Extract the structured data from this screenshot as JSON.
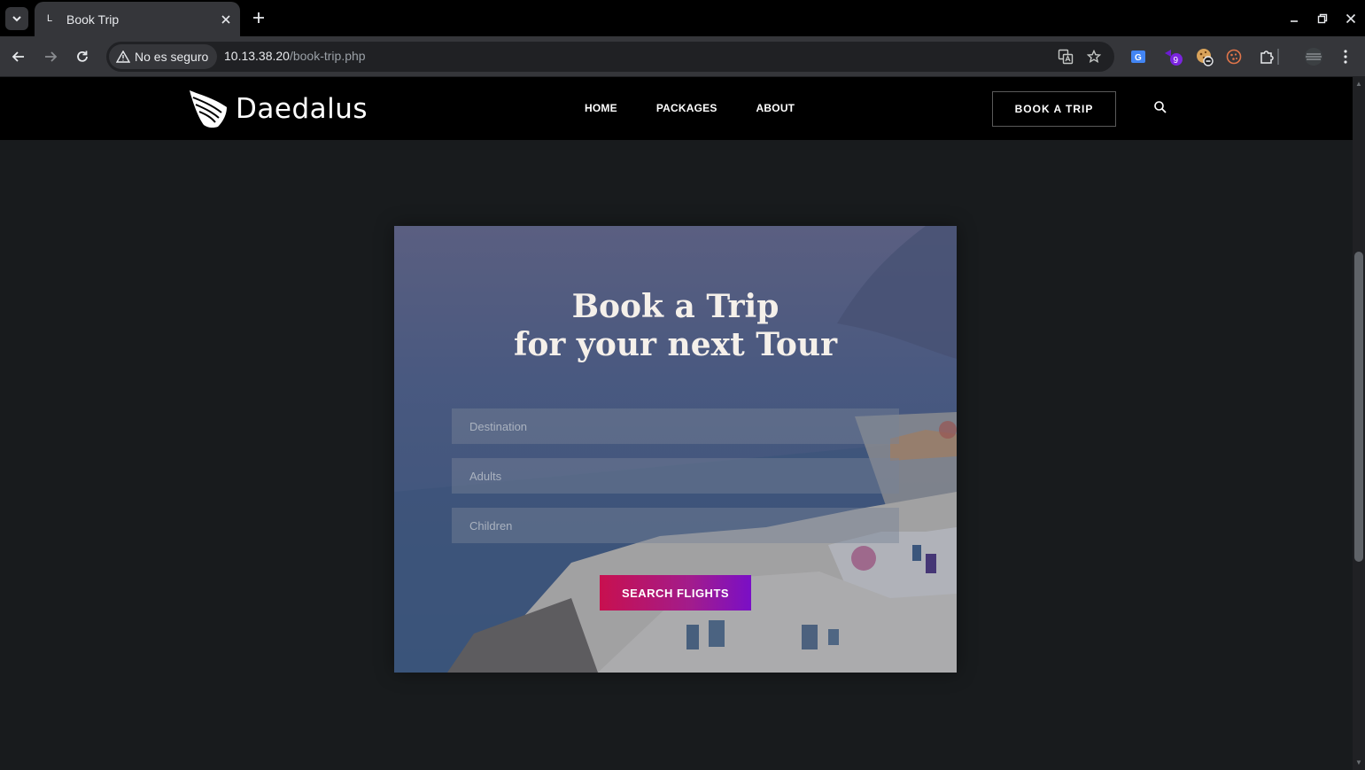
{
  "browser": {
    "tab_title": "Book Trip",
    "tab_favicon": "L",
    "security_label": "No es seguro",
    "url_host": "10.13.38.20",
    "url_path": "/book-trip.php",
    "extension_badge": "9"
  },
  "site": {
    "logo_text": "Daedalus",
    "nav": [
      "HOME",
      "PACKAGES",
      "ABOUT"
    ],
    "cta_label": "BOOK A TRIP"
  },
  "booking": {
    "title_line1": "Book a Trip",
    "title_line2": "for your next Tour",
    "fields": [
      {
        "placeholder": "Destination"
      },
      {
        "placeholder": "Adults"
      },
      {
        "placeholder": "Children"
      }
    ],
    "submit_label": "SEARCH FLIGHTS"
  },
  "colors": {
    "header_bg": "#000000",
    "page_bg": "#181b1d",
    "button_gradient_start": "#c8104f",
    "button_gradient_end": "#7a0fc6"
  }
}
